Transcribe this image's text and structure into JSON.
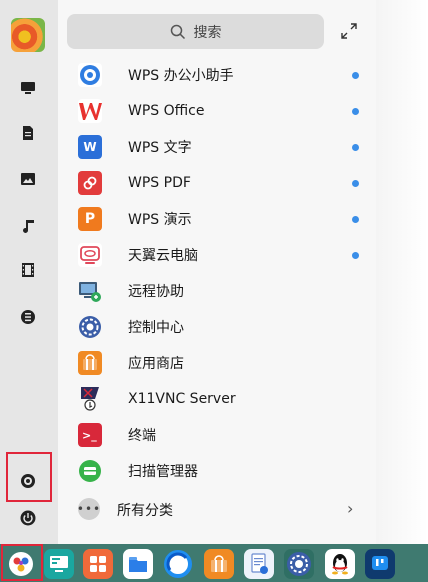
{
  "search": {
    "placeholder": "搜索"
  },
  "apps": [
    {
      "label": "WPS 办公小助手",
      "icon": "wps-assistant-icon",
      "color": "#ffffff",
      "new": true
    },
    {
      "label": "WPS Office",
      "icon": "wps-office-icon",
      "color": "#ffffff",
      "new": true
    },
    {
      "label": "WPS 文字",
      "icon": "wps-writer-icon",
      "color": "#2b6fd8",
      "new": true
    },
    {
      "label": "WPS PDF",
      "icon": "wps-pdf-icon",
      "color": "#e23b3b",
      "new": true
    },
    {
      "label": "WPS 演示",
      "icon": "wps-presentation-icon",
      "color": "#f07a1e",
      "new": true
    },
    {
      "label": "天翼云电脑",
      "icon": "tianyi-cloud-pc-icon",
      "color": "#ffffff",
      "new": true
    },
    {
      "label": "远程协助",
      "icon": "remote-assist-icon",
      "color": "#3c5a78",
      "new": false
    },
    {
      "label": "控制中心",
      "icon": "control-center-icon",
      "color": "#3b5ea8",
      "new": false
    },
    {
      "label": "应用商店",
      "icon": "app-store-icon",
      "color": "#f08a24",
      "new": false
    },
    {
      "label": "X11VNC Server",
      "icon": "x11vnc-icon",
      "color": "#2c2c5a",
      "new": false
    },
    {
      "label": "终端",
      "icon": "terminal-icon",
      "color": "#d8283a",
      "new": false
    },
    {
      "label": "扫描管理器",
      "icon": "scanner-icon",
      "color": "#37b34a",
      "new": false
    }
  ],
  "all_categories": {
    "label": "所有分类"
  },
  "colors": {
    "accent": "#3a8ee8",
    "taskbar": "#3f7a70",
    "highlight_border": "#e0263a"
  },
  "sidebar": {
    "icons": [
      "computer-icon",
      "document-icon",
      "picture-icon",
      "music-icon",
      "video-icon",
      "download-icon",
      "settings-icon",
      "power-icon"
    ]
  },
  "taskbar": {
    "icons": [
      "start-menu-icon",
      "desktop-icon",
      "multitask-icon",
      "file-manager-icon",
      "browser-icon",
      "app-store-icon",
      "document-viewer-icon",
      "control-center-icon",
      "qq-icon",
      "messaging-icon"
    ]
  }
}
